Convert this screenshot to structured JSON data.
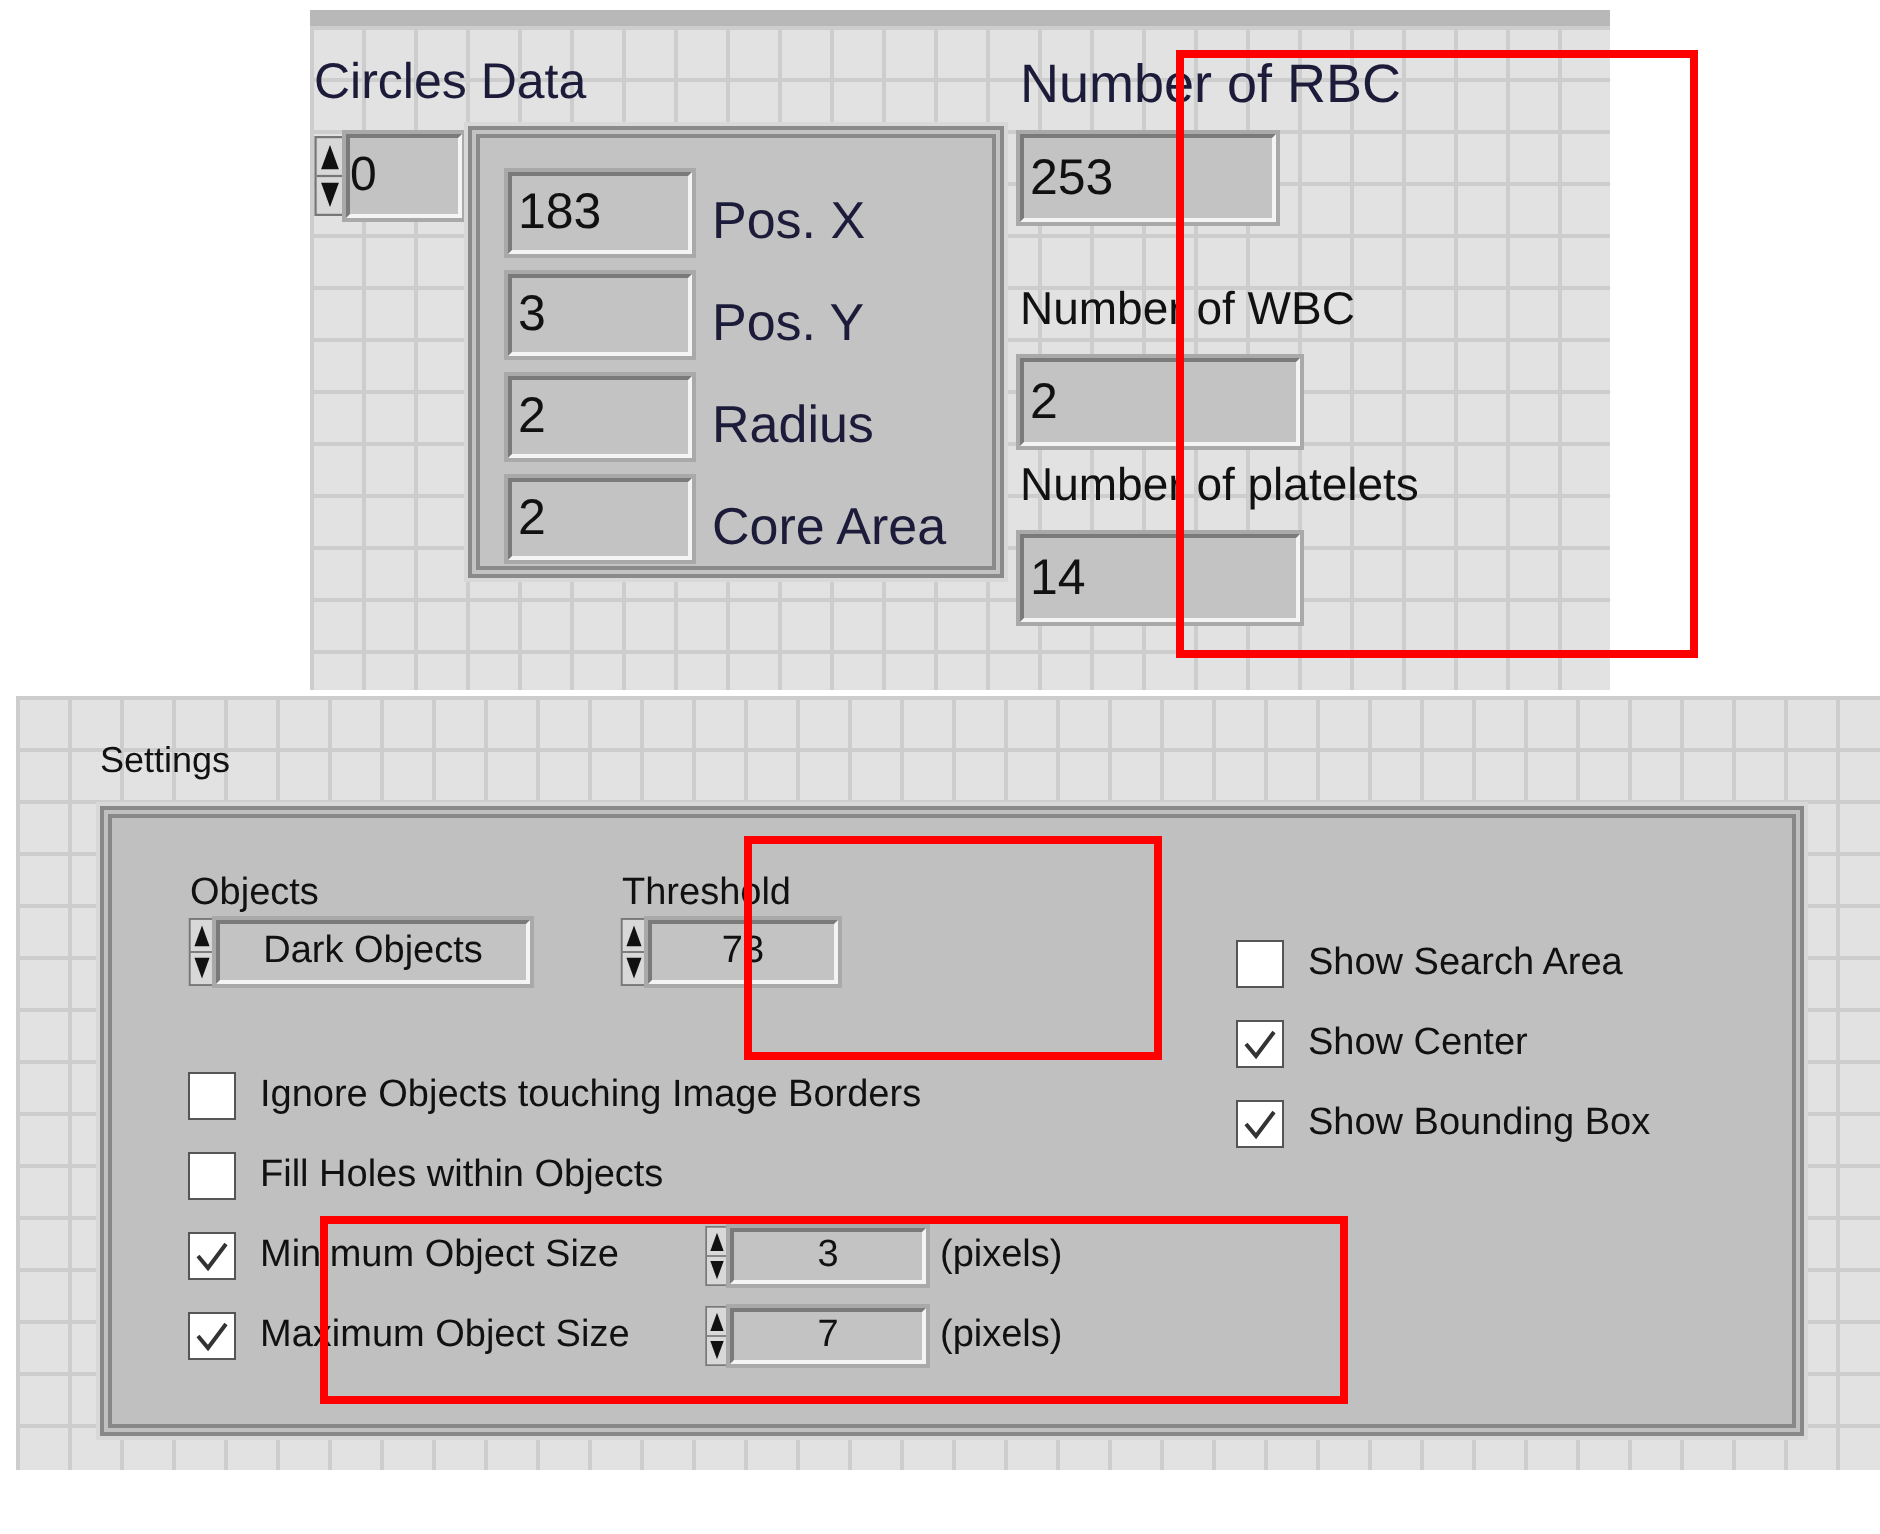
{
  "circles_data": {
    "label": "Circles Data",
    "index": "0",
    "fields": [
      {
        "value": "183",
        "label": "Pos. X"
      },
      {
        "value": "3",
        "label": "Pos. Y"
      },
      {
        "value": "2",
        "label": "Radius"
      },
      {
        "value": "2",
        "label": "Core Area"
      }
    ]
  },
  "counts": [
    {
      "label": "Number of RBC",
      "value": "253"
    },
    {
      "label": "Number of WBC",
      "value": "2"
    },
    {
      "label": "Number of platelets",
      "value": "14"
    }
  ],
  "settings": {
    "title": "Settings",
    "objects": {
      "label": "Objects",
      "value": "Dark Objects"
    },
    "threshold": {
      "label": "Threshold",
      "value": "73"
    },
    "options": [
      {
        "kind": "check",
        "label": "Ignore Objects touching Image Borders",
        "checked": false
      },
      {
        "kind": "check",
        "label": "Fill Holes within Objects",
        "checked": false
      },
      {
        "kind": "size",
        "label": "Minimum Object Size",
        "checked": true,
        "value": "3",
        "unit": "(pixels)"
      },
      {
        "kind": "size",
        "label": "Maximum Object Size",
        "checked": true,
        "value": "7",
        "unit": "(pixels)"
      }
    ],
    "display_options": [
      {
        "label": "Show Search Area",
        "checked": false
      },
      {
        "label": "Show Center",
        "checked": true
      },
      {
        "label": "Show Bounding Box",
        "checked": true
      }
    ]
  },
  "annotation_boxes": [
    {
      "color": "#ff0000"
    },
    {
      "color": "#ff0000"
    },
    {
      "color": "#ff0000"
    }
  ]
}
